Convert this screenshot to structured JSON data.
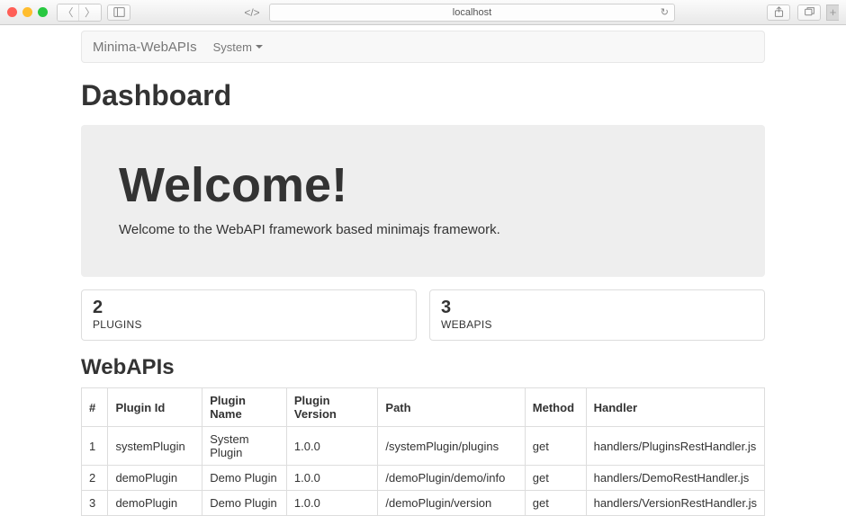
{
  "browser": {
    "url": "localhost"
  },
  "navbar": {
    "brand": "Minima-WebAPIs",
    "menu": "System"
  },
  "page_title": "Dashboard",
  "jumbotron": {
    "heading": "Welcome!",
    "text": "Welcome to the WebAPI framework based minimajs framework."
  },
  "stats": [
    {
      "value": "2",
      "label": "PLUGINS"
    },
    {
      "value": "3",
      "label": "WEBAPIS"
    }
  ],
  "section_webapis": "WebAPIs",
  "table": {
    "headers": [
      "#",
      "Plugin Id",
      "Plugin Name",
      "Plugin Version",
      "Path",
      "Method",
      "Handler"
    ],
    "rows": [
      [
        "1",
        "systemPlugin",
        "System Plugin",
        "1.0.0",
        "/systemPlugin/plugins",
        "get",
        "handlers/PluginsRestHandler.js"
      ],
      [
        "2",
        "demoPlugin",
        "Demo Plugin",
        "1.0.0",
        "/demoPlugin/demo/info",
        "get",
        "handlers/DemoRestHandler.js"
      ],
      [
        "3",
        "demoPlugin",
        "Demo Plugin",
        "1.0.0",
        "/demoPlugin/version",
        "get",
        "handlers/VersionRestHandler.js"
      ]
    ]
  }
}
